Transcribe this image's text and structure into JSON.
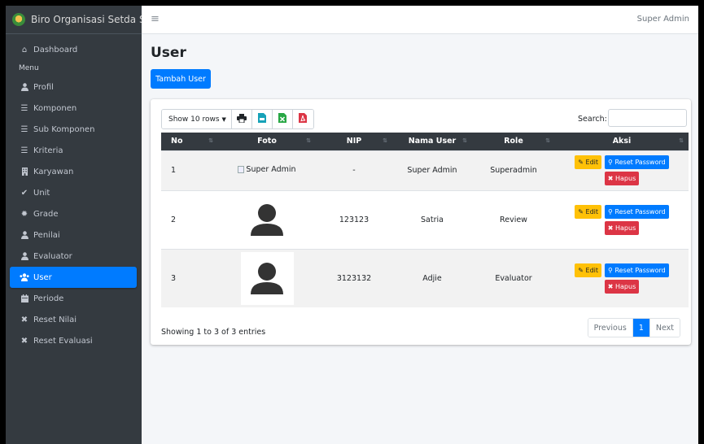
{
  "brand": {
    "title": "Biro Organisasi Setda Su"
  },
  "topbar": {
    "menu_icon": "hamburger-icon",
    "user": "Super Admin"
  },
  "sidebar": {
    "dashboard": "Dashboard",
    "menu_header": "Menu",
    "items": [
      {
        "label": "Profil",
        "icon": "user-icon"
      },
      {
        "label": "Komponen",
        "icon": "list-icon"
      },
      {
        "label": "Sub Komponen",
        "icon": "list-icon"
      },
      {
        "label": "Kriteria",
        "icon": "list-icon"
      },
      {
        "label": "Karyawan",
        "icon": "building-icon"
      },
      {
        "label": "Unit",
        "icon": "check-icon"
      },
      {
        "label": "Grade",
        "icon": "gear-icon"
      },
      {
        "label": "Penilai",
        "icon": "user-icon"
      },
      {
        "label": "Evaluator",
        "icon": "user-icon"
      },
      {
        "label": "User",
        "icon": "users-icon",
        "active": true
      },
      {
        "label": "Periode",
        "icon": "calendar-icon"
      },
      {
        "label": "Reset Nilai",
        "icon": "times-icon"
      },
      {
        "label": "Reset Evaluasi",
        "icon": "times-icon"
      }
    ]
  },
  "page": {
    "title": "User",
    "add_button": "Tambah User"
  },
  "toolbar": {
    "show_rows": "Show 10 rows",
    "search_label": "Search:"
  },
  "table": {
    "headers": [
      "No",
      "Foto",
      "NIP",
      "Nama User",
      "Role",
      "Aksi"
    ],
    "rows": [
      {
        "no": "1",
        "foto_alt": "Super Admin",
        "nip": "-",
        "nama": "Super Admin",
        "role": "Superadmin"
      },
      {
        "no": "2",
        "nip": "123123",
        "nama": "Satria",
        "role": "Review"
      },
      {
        "no": "3",
        "nip": "3123132",
        "nama": "Adjie",
        "role": "Evaluator"
      }
    ],
    "actions": {
      "edit": "Edit",
      "reset": "Reset Password",
      "hapus": "Hapus"
    }
  },
  "footer": {
    "info": "Showing 1 to 3 of 3 entries",
    "prev": "Previous",
    "page": "1",
    "next": "Next"
  },
  "colors": {
    "primary": "#007bff",
    "warning": "#ffc107",
    "danger": "#dc3545",
    "sidebar": "#343a40"
  }
}
